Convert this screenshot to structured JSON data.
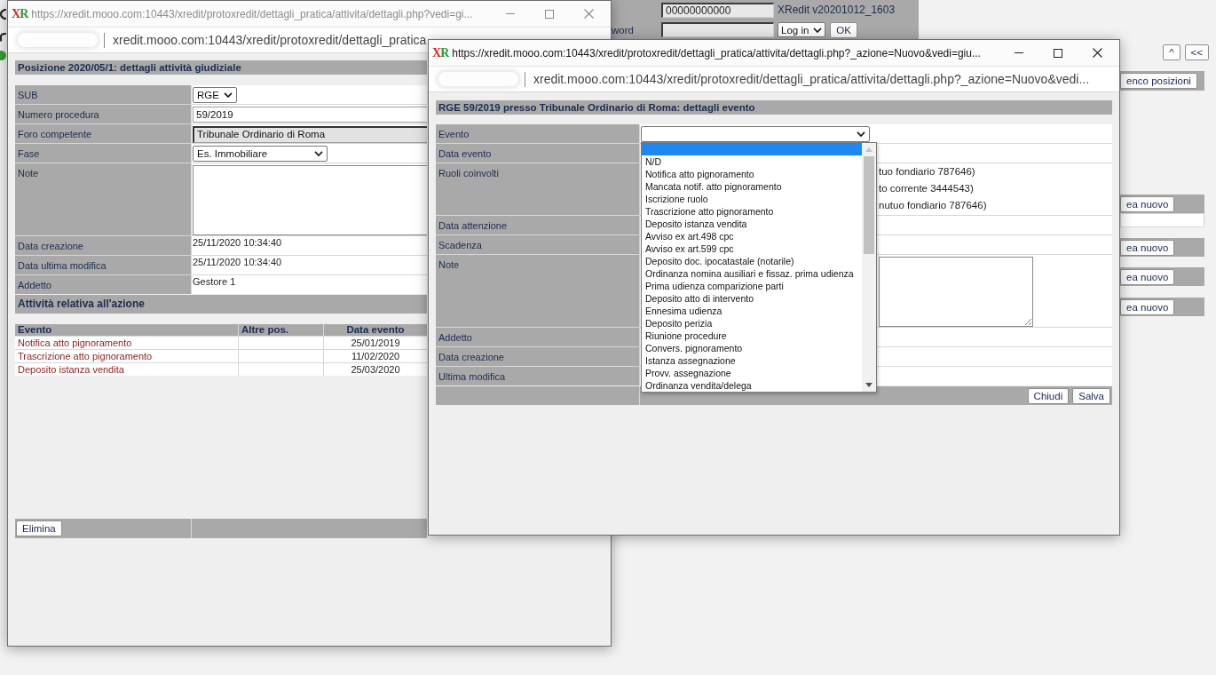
{
  "background_page": {
    "login": {
      "user_value": "00000000000",
      "version": "XRedit v20201012_1603",
      "password_label": "word",
      "action_select": "Log in",
      "ok_button": "OK"
    },
    "nav_buttons": [
      "^",
      "<<"
    ],
    "list_button": "enco posizioni",
    "create_buttons": [
      "ea nuovo",
      "ea nuovo",
      "ea nuovo",
      "ea nuovo"
    ]
  },
  "back_window": {
    "active": false,
    "logo": "XR",
    "title": "https://xredit.mooo.com:10443/xredit/protoxredit/dettagli_pratica/attivita/dettagli.php?vedi=gi...",
    "address": "xredit.mooo.com:10443/xredit/protoxredit/dettagli_pratica",
    "header": "Posizione 2020/05/1: dettagli attività giudiziale",
    "fields": [
      {
        "kind": "select",
        "label": "SUB",
        "value": "RGE"
      },
      {
        "kind": "input",
        "label": "Numero procedura",
        "value": "59/2019"
      },
      {
        "kind": "readonly",
        "label": "Foro competente",
        "value": "Tribunale Ordinario di Roma"
      },
      {
        "kind": "select",
        "label": "Fase",
        "value": "Es. Immobiliare"
      },
      {
        "kind": "textarea",
        "label": "Note"
      },
      {
        "kind": "text",
        "label": "Data creazione",
        "value": "25/11/2020 10:34:40"
      },
      {
        "kind": "text",
        "label": "Data ultima modifica",
        "value": "25/11/2020 10:34:40"
      },
      {
        "kind": "text",
        "label": "Addetto",
        "value": "Gestore 1"
      }
    ],
    "section": "Attività relativa all'azione",
    "table": {
      "columns": [
        "Evento",
        "Altre pos.",
        "Data evento"
      ],
      "rows": [
        {
          "evento": "Notifica atto pignoramento",
          "data_evento": "25/01/2019"
        },
        {
          "evento": "Trascrizione atto pignoramento",
          "data_evento": "11/02/2020"
        },
        {
          "evento": "Deposito istanza vendita",
          "data_evento": "25/03/2020"
        }
      ]
    },
    "buttons": [
      "Elimina"
    ]
  },
  "front_window": {
    "active": true,
    "logo": "XR",
    "title": "https://xredit.mooo.com:10443/xredit/protoxredit/dettagli_pratica/attivita/dettagli.php?_azione=Nuovo&vedi=giu...",
    "address": "xredit.mooo.com:10443/xredit/protoxredit/dettagli_pratica/attivita/dettagli.php?_azione=Nuovo&vedi...",
    "header": "RGE 59/2019 presso Tribunale Ordinario di Roma: dettagli evento",
    "fields": [
      {
        "kind": "select",
        "label": "Evento",
        "open": true,
        "options": [
          {
            "selected": true
          },
          {
            "label": "N/D",
            "selected": false
          },
          {
            "label": "Notifica atto pignoramento",
            "selected": false
          },
          {
            "label": "Mancata notif. atto pignoramento",
            "selected": false
          },
          {
            "label": "Iscrizione ruolo",
            "selected": false
          },
          {
            "label": "Trascrizione atto pignoramento",
            "selected": false
          },
          {
            "label": "Deposito istanza vendita",
            "selected": false
          },
          {
            "label": "Avviso ex art.498 cpc",
            "selected": false
          },
          {
            "label": "Avviso ex art.599 cpc",
            "selected": false
          },
          {
            "label": "Deposito doc. ipocatastale (notarile)",
            "selected": false
          },
          {
            "label": "Ordinanza nomina ausiliari e fissaz. prima udienza",
            "selected": false
          },
          {
            "label": "Prima udienza comparizione parti",
            "selected": false
          },
          {
            "label": "Deposito atto di intervento",
            "selected": false
          },
          {
            "label": "Ennesima udienza",
            "selected": false
          },
          {
            "label": "Deposito perizia",
            "selected": false
          },
          {
            "label": "Riunione procedure",
            "selected": false
          },
          {
            "label": "Convers. pignoramento",
            "selected": false
          },
          {
            "label": "Istanza assegnazione",
            "selected": false
          },
          {
            "label": "Provv. assegnazione",
            "selected": false
          },
          {
            "label": "Ordinanza vendita/delega",
            "selected": false
          }
        ]
      },
      {
        "kind": "blank",
        "label": "Data evento"
      },
      {
        "kind": "lines",
        "label": "Ruoli coinvolti",
        "lines": [
          "tuo fondiario 787646)",
          "to corrente 3444543)",
          "nutuo fondiario 787646)"
        ]
      },
      {
        "kind": "blank",
        "label": "Data attenzione"
      },
      {
        "kind": "blank",
        "label": "Scadenza"
      },
      {
        "kind": "textarea",
        "label": "Note"
      },
      {
        "kind": "blank",
        "label": "Addetto"
      },
      {
        "kind": "blank",
        "label": "Data creazione"
      },
      {
        "kind": "blank",
        "label": "Ultima modifica"
      }
    ],
    "buttons": [
      "Chiudi",
      "Salva"
    ]
  }
}
